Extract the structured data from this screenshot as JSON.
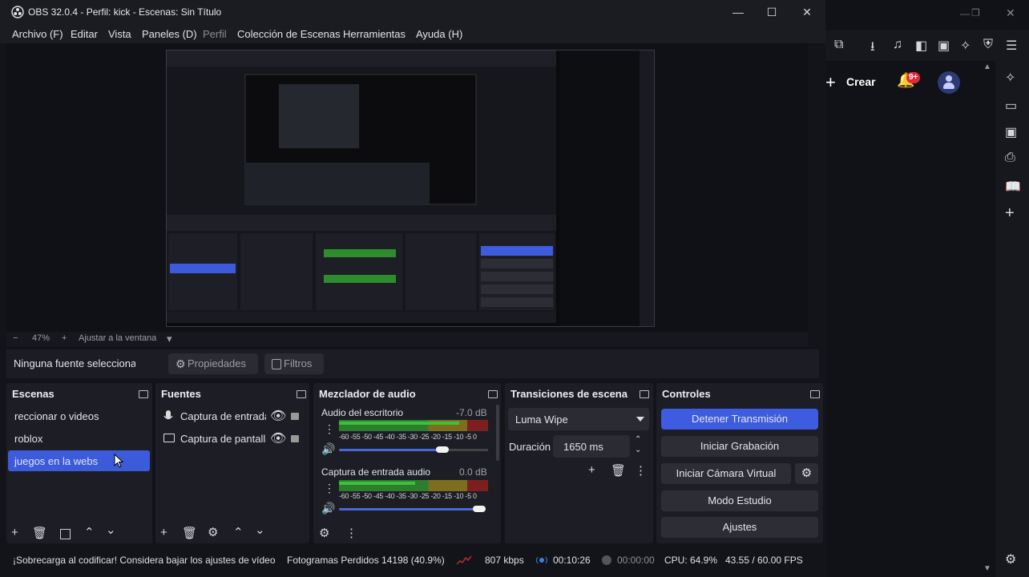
{
  "window": {
    "title": "OBS 32.0.4 - Perfil: kick - Escenas: Sin Título",
    "minimize": "—",
    "maximize": "☐",
    "close": "✕"
  },
  "menu": [
    "Archivo (F)",
    "Editar",
    "Vista",
    "Paneles (D)",
    "Perfil",
    "Colección de Escenas",
    "Herramientas",
    "Ayuda (H)"
  ],
  "zoom": {
    "minus": "−",
    "level": "47%",
    "plus": "+",
    "fit": "Ajustar a la ventana",
    "caret": "▾"
  },
  "context": {
    "no_source": "Ninguna fuente seleccionada",
    "properties": "Propiedades",
    "filters": "Filtros"
  },
  "docks": {
    "scenes": {
      "title": "Escenas",
      "items": [
        "reccionar o videos",
        "roblox",
        "juegos en la webs"
      ],
      "selected_index": 2
    },
    "sources": {
      "title": "Fuentes",
      "items": [
        {
          "icon": "microphone-icon",
          "label": "Captura de entrada de audio"
        },
        {
          "icon": "monitor-icon",
          "label": "Captura de pantalla"
        }
      ]
    },
    "mixer": {
      "title": "Mezclador de audio",
      "channels": [
        {
          "name": "Audio del escritorio",
          "db": "-7.0 dB",
          "volume": 0.85
        },
        {
          "name": "Captura de entrada audio",
          "db": "0.0 dB",
          "volume": 1.0
        }
      ],
      "scale": [
        "-60",
        "-55",
        "-50",
        "-45",
        "-40",
        "-35",
        "-30",
        "-25",
        "-20",
        "-15",
        "-10",
        "-5",
        "0"
      ]
    },
    "transitions": {
      "title": "Transiciones de escena",
      "selected": "Luma Wipe",
      "duration_label": "Duración",
      "duration_value": "1650 ms"
    },
    "controls": {
      "title": "Controles",
      "buttons": [
        "Detener Transmisión",
        "Iniciar Grabación",
        "Iniciar Cámara Virtual",
        "Modo Estudio",
        "Ajustes"
      ]
    }
  },
  "status": {
    "warning": "¡Sobrecarga al codificar! Considera bajar los ajustes de vídeo",
    "dropped": "Fotogramas Perdidos 14198 (40.9%)",
    "bitrate": "807 kbps",
    "stream_time": "00:10:26",
    "rec_time": "00:00:00",
    "cpu": "CPU: 64.9%",
    "fps": "43.55 / 60.00 FPS"
  },
  "browser": {
    "create": "Crear",
    "notifications": "9+"
  },
  "colors": {
    "accent": "#3d5ce0",
    "meter_green": "#39c339",
    "meter_yellow": "#c9b430",
    "meter_red": "#b8302f"
  }
}
